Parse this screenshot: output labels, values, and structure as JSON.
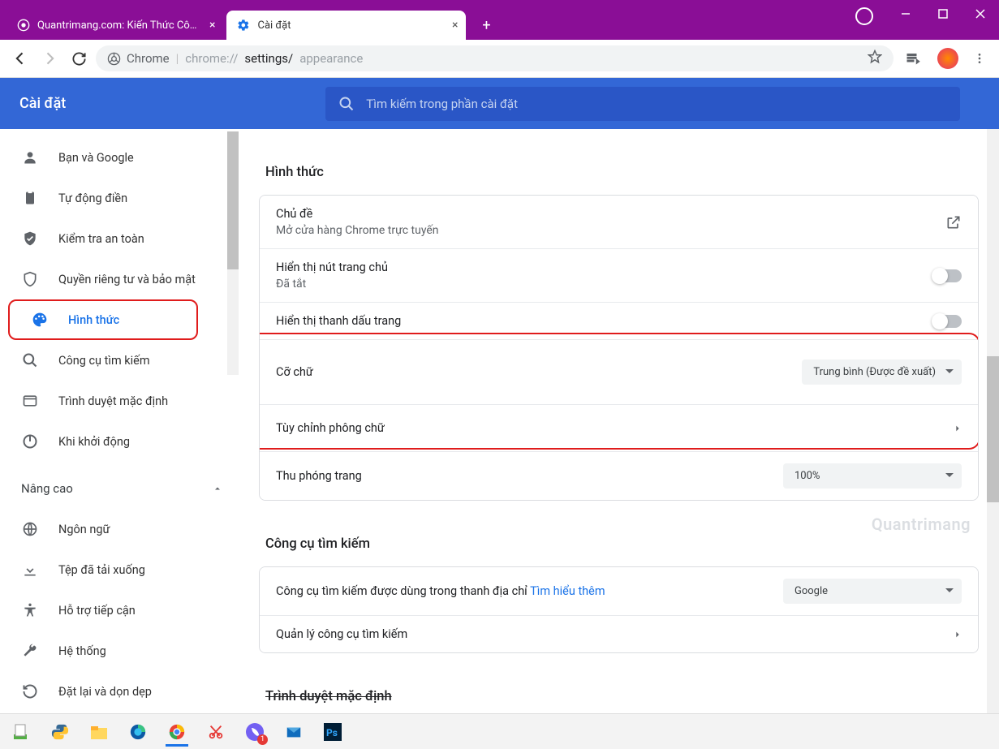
{
  "titlebar": {
    "tabs": [
      {
        "title": "Quantrimang.com: Kiến Thức Công",
        "active": false
      },
      {
        "title": "Cài đặt",
        "active": true
      }
    ]
  },
  "toolbar": {
    "chrome_label": "Chrome",
    "url_prefix": "chrome://",
    "url_mid": "settings/",
    "url_suffix": "appearance"
  },
  "header": {
    "title": "Cài đặt",
    "search_placeholder": "Tìm kiếm trong phần cài đặt"
  },
  "sidebar": {
    "items": [
      {
        "icon": "person",
        "label": "Bạn và Google"
      },
      {
        "icon": "clipboard",
        "label": "Tự động điền"
      },
      {
        "icon": "shieldcheck",
        "label": "Kiểm tra an toàn"
      },
      {
        "icon": "shield",
        "label": "Quyền riêng tư và bảo mật"
      },
      {
        "icon": "palette",
        "label": "Hình thức",
        "active": true
      },
      {
        "icon": "search",
        "label": "Công cụ tìm kiếm"
      },
      {
        "icon": "browser",
        "label": "Trình duyệt mặc định"
      },
      {
        "icon": "power",
        "label": "Khi khởi động"
      }
    ],
    "advanced": "Nâng cao",
    "advanced_items": [
      {
        "icon": "globe",
        "label": "Ngôn ngữ"
      },
      {
        "icon": "download",
        "label": "Tệp đã tải xuống"
      },
      {
        "icon": "accessibility",
        "label": "Hỗ trợ tiếp cận"
      },
      {
        "icon": "wrench",
        "label": "Hệ thống"
      },
      {
        "icon": "restore",
        "label": "Đặt lại và dọn dẹp"
      }
    ]
  },
  "main": {
    "section1_title": "Hình thức",
    "theme_title": "Chủ đề",
    "theme_sub": "Mở cửa hàng Chrome trực tuyến",
    "homebtn_title": "Hiển thị nút trang chủ",
    "homebtn_status": "Đã tắt",
    "bookmarks_title": "Hiển thị thanh dấu trang",
    "fontsize_title": "Cỡ chữ",
    "fontsize_value": "Trung bình (Được đề xuất)",
    "customfonts_title": "Tùy chỉnh phông chữ",
    "zoom_title": "Thu phóng trang",
    "zoom_value": "100%",
    "section2_title": "Công cụ tìm kiếm",
    "se_desc": "Công cụ tìm kiếm được dùng trong thanh địa chỉ ",
    "se_learn": "Tìm hiểu thêm",
    "se_value": "Google",
    "se_manage": "Quản lý công cụ tìm kiếm",
    "section3_title": "Trình duyệt mặc định"
  },
  "watermark": "Quantrimang",
  "taskbar": {
    "notification_count": "1"
  }
}
